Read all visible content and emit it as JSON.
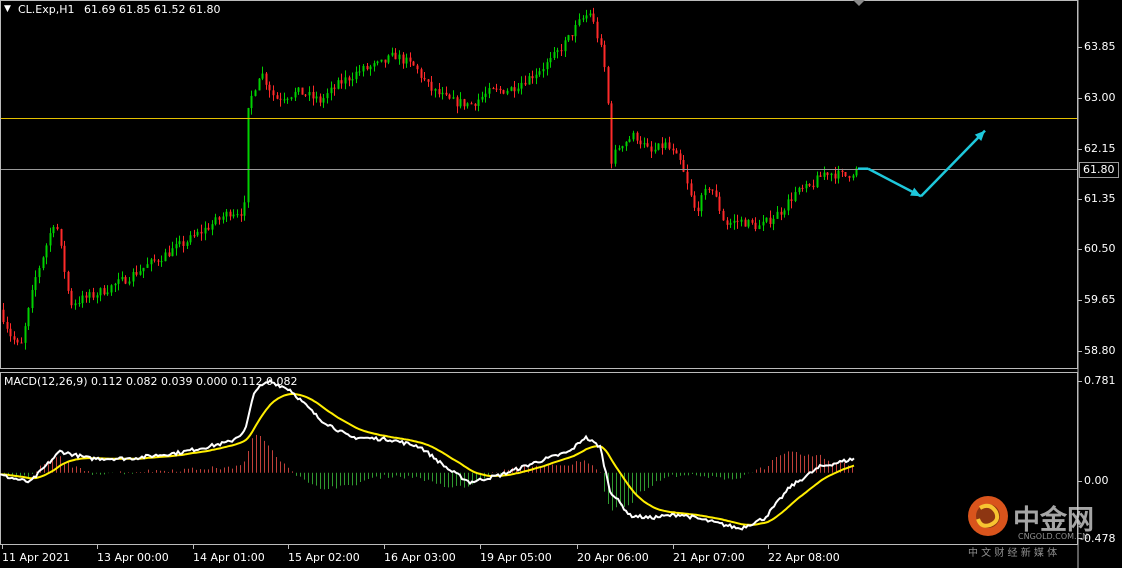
{
  "header": {
    "menu_icon": "triangle-down-icon",
    "symbol": "CL.Exp,H1",
    "ohlc": "61.69 61.85 61.52 61.80"
  },
  "macd_header": {
    "label": "MACD(12,26,9) 0.112 0.082 0.039 0.000 0.112 0.082"
  },
  "price_axis": {
    "ticks": [
      "63.85",
      "63.00",
      "62.15",
      "61.35",
      "60.50",
      "59.65",
      "58.80"
    ],
    "current_price": "61.80"
  },
  "macd_axis": {
    "ticks": [
      "0.781",
      "0.00",
      "-0.478"
    ]
  },
  "time_axis": {
    "ticks": [
      "11 Apr 2021",
      "13 Apr 00:00",
      "14 Apr 01:00",
      "15 Apr 02:00",
      "16 Apr 03:00",
      "19 Apr 05:00",
      "20 Apr 06:00",
      "21 Apr 07:00",
      "22 Apr 08:00"
    ]
  },
  "watermark": {
    "logo_icon": "cngold-logo-icon",
    "brand": "中金网",
    "site": "CNGOLD.COM.CN",
    "slogan": "中 文 财 经 新 媒 体"
  },
  "colors": {
    "background": "#000000",
    "bull_candle": "#00d000",
    "bear_candle": "#ff2a2a",
    "resistance_line": "#e3c000",
    "current_price_line": "#9a9a9a",
    "projection_arrow": "#1ec8dc",
    "macd_line": "#ffffff",
    "signal_line": "#ffee00",
    "hist_positive": "#c0403a",
    "hist_negative": "#2f9a2f"
  },
  "chart_data": {
    "type": "candlestick",
    "symbol": "CL.Exp",
    "timeframe": "H1",
    "ylim": [
      58.55,
      64.55
    ],
    "horizontal_lines": [
      {
        "name": "resistance",
        "value": 62.62
      },
      {
        "name": "current",
        "value": 61.8
      }
    ],
    "price_waypoints": [
      [
        0,
        59.5
      ],
      [
        10,
        59.1
      ],
      [
        20,
        58.85
      ],
      [
        35,
        60.0
      ],
      [
        55,
        61.0
      ],
      [
        70,
        59.6
      ],
      [
        95,
        59.75
      ],
      [
        120,
        59.95
      ],
      [
        150,
        60.25
      ],
      [
        190,
        60.65
      ],
      [
        230,
        61.1
      ],
      [
        244,
        61.1
      ],
      [
        248,
        62.8
      ],
      [
        260,
        63.4
      ],
      [
        275,
        62.95
      ],
      [
        300,
        63.05
      ],
      [
        320,
        62.9
      ],
      [
        340,
        63.2
      ],
      [
        360,
        63.4
      ],
      [
        380,
        63.5
      ],
      [
        395,
        63.65
      ],
      [
        415,
        63.45
      ],
      [
        430,
        63.1
      ],
      [
        450,
        62.9
      ],
      [
        470,
        62.85
      ],
      [
        490,
        63.05
      ],
      [
        510,
        63.1
      ],
      [
        530,
        63.3
      ],
      [
        550,
        63.55
      ],
      [
        565,
        63.85
      ],
      [
        580,
        64.2
      ],
      [
        590,
        64.35
      ],
      [
        600,
        63.8
      ],
      [
        607,
        63.2
      ],
      [
        610,
        61.9
      ],
      [
        620,
        62.2
      ],
      [
        635,
        62.35
      ],
      [
        650,
        62.05
      ],
      [
        665,
        62.2
      ],
      [
        680,
        61.9
      ],
      [
        695,
        61.1
      ],
      [
        710,
        61.55
      ],
      [
        725,
        60.9
      ],
      [
        740,
        60.95
      ],
      [
        760,
        60.85
      ],
      [
        780,
        61.1
      ],
      [
        795,
        61.4
      ],
      [
        810,
        61.5
      ],
      [
        825,
        61.75
      ],
      [
        845,
        61.68
      ],
      [
        858,
        61.8
      ]
    ],
    "projection_path": [
      [
        858,
        61.8
      ],
      [
        868,
        61.8
      ],
      [
        921,
        61.35
      ],
      [
        985,
        62.42
      ]
    ],
    "macd_ylim": [
      -0.6,
      0.84
    ],
    "macd_waypoints": [
      [
        0,
        -0.02
      ],
      [
        30,
        -0.08
      ],
      [
        60,
        0.18
      ],
      [
        90,
        0.12
      ],
      [
        130,
        0.12
      ],
      [
        180,
        0.17
      ],
      [
        230,
        0.26
      ],
      [
        245,
        0.35
      ],
      [
        255,
        0.7
      ],
      [
        270,
        0.77
      ],
      [
        290,
        0.7
      ],
      [
        320,
        0.45
      ],
      [
        350,
        0.3
      ],
      [
        390,
        0.28
      ],
      [
        420,
        0.22
      ],
      [
        450,
        0.02
      ],
      [
        470,
        -0.08
      ],
      [
        500,
        -0.02
      ],
      [
        540,
        0.1
      ],
      [
        570,
        0.18
      ],
      [
        585,
        0.3
      ],
      [
        600,
        0.22
      ],
      [
        610,
        -0.15
      ],
      [
        630,
        -0.36
      ],
      [
        650,
        -0.38
      ],
      [
        680,
        -0.35
      ],
      [
        710,
        -0.41
      ],
      [
        740,
        -0.47
      ],
      [
        765,
        -0.38
      ],
      [
        790,
        -0.12
      ],
      [
        820,
        0.05
      ],
      [
        855,
        0.12
      ]
    ]
  }
}
